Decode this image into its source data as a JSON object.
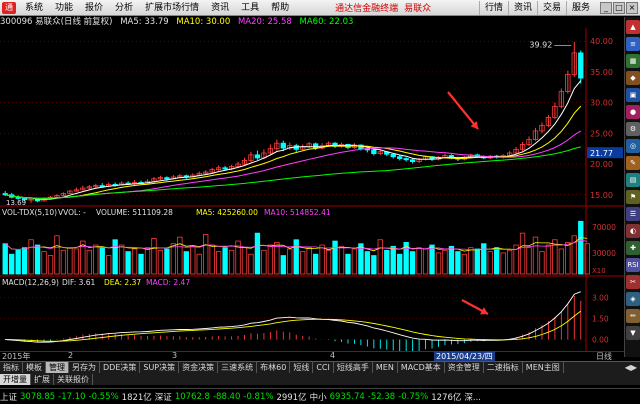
{
  "menubar": {
    "items": [
      "系统",
      "功能",
      "报价",
      "分析",
      "扩展市场行情",
      "资讯",
      "工具",
      "帮助"
    ],
    "promo": "通达信金融终端",
    "stock_name": "易联众",
    "right_buttons": [
      "行情",
      "资讯",
      "交易",
      "服务"
    ],
    "window_buttons": [
      "_",
      "□",
      "×"
    ]
  },
  "infoline": {
    "code_name": "300096 易联众(日线 前复权)",
    "ma5": "MA5: 33.79",
    "ma10": "MA10: 30.00",
    "ma20": "MA20: 25.58",
    "ma60": "MA60: 22.03"
  },
  "colors": {
    "up": "#ff3c3c",
    "down": "#00ffff",
    "ma5": "#ffffff",
    "ma10": "#ffff00",
    "ma20": "#ff40ff",
    "ma60": "#00ff00",
    "axis": "#a00000",
    "grid": "#a00000"
  },
  "chart_data": [
    {
      "type": "candlestick",
      "yaxis": {
        "min": 15,
        "max": 40,
        "ticks": [
          "40.00",
          "35.00",
          "30.00",
          "25.00",
          "20.00",
          "15.00"
        ]
      },
      "max_label": "39.92",
      "min_label": "13.69",
      "current_price_label": "21.77",
      "candles": [
        [
          15.2,
          15.0,
          15.6,
          14.8
        ],
        [
          15.0,
          14.6,
          15.3,
          14.4
        ],
        [
          14.6,
          14.4,
          14.9,
          14.2
        ],
        [
          14.4,
          14.2,
          14.6,
          13.9
        ],
        [
          14.2,
          14.3,
          14.5,
          13.7
        ],
        [
          14.3,
          14.0,
          14.5,
          13.8
        ],
        [
          14.0,
          14.4,
          14.6,
          13.9
        ],
        [
          14.4,
          14.6,
          14.8,
          14.3
        ],
        [
          14.6,
          14.9,
          15.1,
          14.5
        ],
        [
          14.9,
          15.2,
          15.4,
          14.8
        ],
        [
          15.2,
          15.6,
          15.8,
          15.1
        ],
        [
          15.6,
          15.8,
          16.2,
          15.5
        ],
        [
          15.8,
          16.1,
          16.5,
          15.7
        ],
        [
          16.1,
          16.3,
          16.6,
          15.9
        ],
        [
          16.3,
          16.5,
          16.8,
          16.1
        ],
        [
          16.5,
          16.4,
          16.9,
          16.2
        ],
        [
          16.4,
          16.7,
          17.0,
          16.2
        ],
        [
          16.7,
          16.6,
          17.0,
          16.3
        ],
        [
          16.6,
          16.9,
          17.2,
          16.5
        ],
        [
          16.9,
          16.8,
          17.2,
          16.6
        ],
        [
          16.8,
          17.0,
          17.4,
          16.6
        ],
        [
          17.0,
          16.9,
          17.3,
          16.7
        ],
        [
          16.9,
          17.2,
          17.5,
          16.8
        ],
        [
          17.2,
          17.6,
          17.9,
          17.0
        ],
        [
          17.6,
          17.8,
          18.1,
          17.4
        ],
        [
          17.8,
          17.6,
          18.0,
          17.3
        ],
        [
          17.6,
          17.9,
          18.2,
          17.5
        ],
        [
          17.9,
          18.1,
          18.4,
          17.8
        ],
        [
          18.1,
          17.9,
          18.3,
          17.6
        ],
        [
          17.9,
          18.2,
          18.5,
          17.8
        ],
        [
          18.2,
          18.5,
          18.8,
          18.0
        ],
        [
          18.5,
          18.7,
          19.0,
          18.3
        ],
        [
          18.7,
          19.1,
          19.4,
          18.5
        ],
        [
          19.1,
          19.4,
          19.8,
          18.9
        ],
        [
          19.4,
          19.2,
          19.7,
          18.9
        ],
        [
          19.2,
          19.6,
          19.9,
          19.0
        ],
        [
          19.6,
          20.0,
          20.4,
          19.4
        ],
        [
          20.0,
          20.6,
          21.0,
          19.8
        ],
        [
          20.6,
          21.5,
          22.0,
          20.3
        ],
        [
          21.5,
          21.0,
          22.2,
          20.7
        ],
        [
          21.0,
          21.8,
          22.4,
          20.8
        ],
        [
          21.8,
          22.5,
          23.2,
          21.6
        ],
        [
          22.5,
          23.4,
          24.0,
          22.2
        ],
        [
          23.4,
          22.6,
          23.8,
          22.1
        ],
        [
          22.6,
          23.0,
          23.5,
          22.3
        ],
        [
          23.0,
          22.4,
          23.3,
          22.0
        ],
        [
          22.4,
          22.8,
          23.2,
          22.1
        ],
        [
          22.8,
          23.3,
          23.6,
          22.6
        ],
        [
          23.3,
          22.6,
          23.5,
          22.3
        ],
        [
          22.6,
          23.0,
          23.4,
          22.4
        ],
        [
          23.0,
          23.4,
          23.7,
          22.8
        ],
        [
          23.4,
          22.9,
          23.6,
          22.6
        ],
        [
          22.9,
          23.2,
          23.5,
          22.7
        ],
        [
          23.2,
          22.7,
          23.3,
          22.4
        ],
        [
          22.7,
          23.1,
          23.4,
          22.5
        ],
        [
          23.1,
          22.5,
          23.2,
          22.2
        ],
        [
          22.5,
          22.3,
          22.7,
          21.9
        ],
        [
          22.3,
          21.7,
          22.4,
          21.4
        ],
        [
          21.7,
          22.0,
          22.3,
          21.5
        ],
        [
          22.0,
          21.6,
          22.1,
          21.3
        ],
        [
          21.6,
          21.2,
          21.8,
          20.9
        ],
        [
          21.2,
          20.9,
          21.4,
          20.6
        ],
        [
          20.9,
          20.7,
          21.1,
          20.4
        ],
        [
          20.7,
          20.4,
          20.9,
          20.1
        ],
        [
          20.4,
          20.8,
          21.0,
          20.2
        ],
        [
          20.8,
          21.2,
          21.4,
          20.6
        ],
        [
          21.2,
          20.8,
          21.3,
          20.5
        ],
        [
          20.8,
          21.1,
          21.3,
          20.6
        ],
        [
          21.1,
          21.4,
          21.7,
          20.9
        ],
        [
          21.4,
          21.0,
          21.6,
          20.8
        ],
        [
          21.0,
          20.8,
          21.2,
          20.5
        ],
        [
          20.8,
          21.1,
          21.3,
          20.6
        ],
        [
          21.1,
          21.5,
          21.7,
          20.9
        ],
        [
          21.5,
          21.2,
          21.7,
          21.0
        ],
        [
          21.2,
          21.0,
          21.4,
          20.8
        ],
        [
          21.0,
          21.3,
          21.5,
          20.8
        ],
        [
          21.3,
          21.1,
          21.5,
          20.9
        ],
        [
          21.1,
          21.4,
          21.6,
          20.9
        ],
        [
          21.4,
          21.8,
          22.1,
          21.2
        ],
        [
          21.8,
          22.4,
          22.8,
          21.6
        ],
        [
          22.4,
          23.2,
          23.6,
          22.1
        ],
        [
          23.2,
          24.0,
          24.5,
          22.9
        ],
        [
          24.0,
          25.4,
          25.9,
          23.8
        ],
        [
          25.4,
          26.3,
          26.8,
          25.0
        ],
        [
          26.3,
          27.6,
          28.0,
          26.0
        ],
        [
          27.6,
          29.4,
          30.0,
          27.3
        ],
        [
          29.4,
          31.8,
          32.3,
          29.1
        ],
        [
          31.8,
          34.6,
          35.2,
          31.5
        ],
        [
          34.6,
          38.1,
          39.9,
          34.2
        ],
        [
          38.1,
          34.0,
          38.5,
          33.1
        ]
      ],
      "ma_series": [
        "MA5",
        "MA10",
        "MA20",
        "MA60"
      ]
    },
    {
      "type": "bar",
      "title": "VOL-TDX(5,10)",
      "subtitle": "VVOL: -",
      "volume_label": "VOLUME: 511109.28",
      "ma5_label": "MA5: 425260.00",
      "ma10_label": "MA10: 514852.41",
      "yaxis_ticks": [
        "70000",
        "30000",
        "X10"
      ],
      "values": [
        46,
        30,
        36,
        40,
        52,
        44,
        34,
        28,
        58,
        36,
        40,
        38,
        50,
        36,
        44,
        40,
        28,
        52,
        44,
        34,
        38,
        30,
        40,
        54,
        36,
        38,
        46,
        56,
        34,
        42,
        30,
        60,
        44,
        34,
        40,
        36,
        50,
        40,
        30,
        62,
        36,
        44,
        48,
        28,
        38,
        52,
        34,
        40,
        30,
        44,
        36,
        50,
        42,
        30,
        38,
        46,
        34,
        28,
        52,
        36,
        42,
        30,
        48,
        34,
        40,
        38,
        44,
        32,
        36,
        42,
        34,
        30,
        40,
        38,
        46,
        34,
        40,
        32,
        36,
        44,
        62,
        40,
        56,
        34,
        44,
        52,
        38,
        48,
        58,
        80,
        46
      ]
    },
    {
      "type": "line",
      "title": "MACD(12,26,9)",
      "dif_label": "DIF: 3.61",
      "dea_label": "DEA: 2.37",
      "macd_label": "MACD: 2.47",
      "yaxis_ticks": [
        "3.00",
        "1.50",
        "0.00"
      ]
    }
  ],
  "dateaxis": {
    "labels": [
      "2015年",
      "2",
      "3",
      "4"
    ],
    "highlight": "2015/04/23/四",
    "right": "日线"
  },
  "tabs": [
    "指标",
    "模板",
    "管理",
    "另存为",
    "DDE决策",
    "SUP决策",
    "资金决策",
    "三速系统",
    "布林60",
    "短线",
    "CCI",
    "短线高手",
    "MEN",
    "MACD基本",
    "资金管理",
    "二速指标",
    "MEN主图"
  ],
  "tabs_active": "管理",
  "tabs2": [
    "开增量",
    "扩展",
    "关联报价"
  ],
  "status": {
    "sh_label": "上证",
    "sh_val": "3078.85",
    "sh_chg": "-17.10",
    "sh_pct": "-0.55%",
    "sh_amt": "1821亿",
    "sz_label": "深证",
    "sz_val": "10762.8",
    "sz_chg": "-88.40",
    "sz_pct": "-0.81%",
    "sz_amt": "2991亿",
    "zx_label": "中小",
    "zx_val": "6935.74",
    "zx_chg": "-52.38",
    "zx_pct": "-0.75%",
    "zx_amt": "1276亿",
    "end": "深..."
  }
}
